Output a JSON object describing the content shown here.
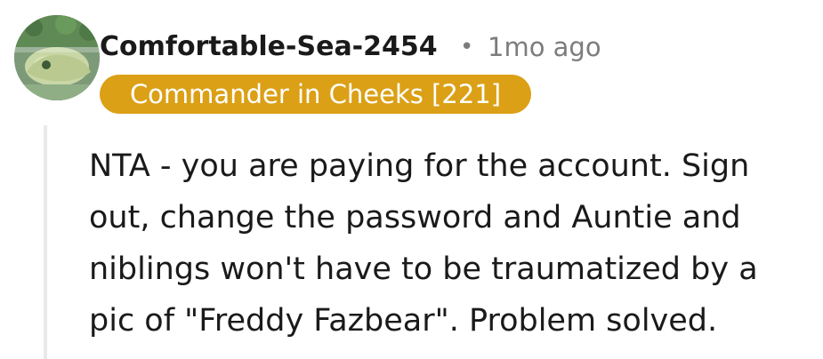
{
  "comment": {
    "author": "Comfortable-Sea-2454",
    "separator": "•",
    "timestamp": "1mo ago",
    "flair": "Commander in Cheeks [221]",
    "body": "NTA - you are paying for the account. Sign out, change the password and Auntie and niblings won't have to be traumatized by a pic of \"Freddy Fazbear\". Problem solved."
  },
  "colors": {
    "flair_background": "#dba016",
    "flair_text": "#ffffff",
    "timestamp": "#7c7c7c",
    "thread_line": "#e9e9e9"
  },
  "icons": {
    "avatar": "user-avatar-image"
  }
}
